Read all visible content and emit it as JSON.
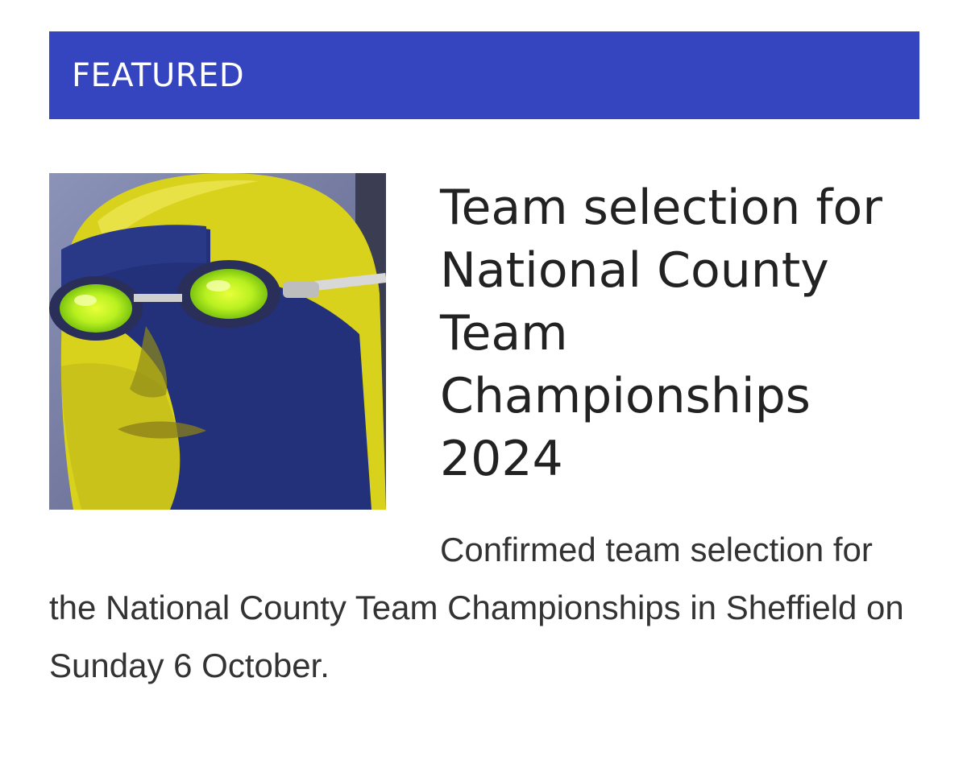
{
  "section": {
    "label": "FEATURED",
    "color": "#3545c0"
  },
  "article": {
    "image": {
      "alt": "Swimmer with blue and yellow face paint wearing green goggles",
      "icon": "featured-photo"
    },
    "title": "Team selection for National County Team Championships 2024",
    "excerpt": "Confirmed team selection for the National County Team Championships in Sheffield on Sunday 6 October."
  }
}
